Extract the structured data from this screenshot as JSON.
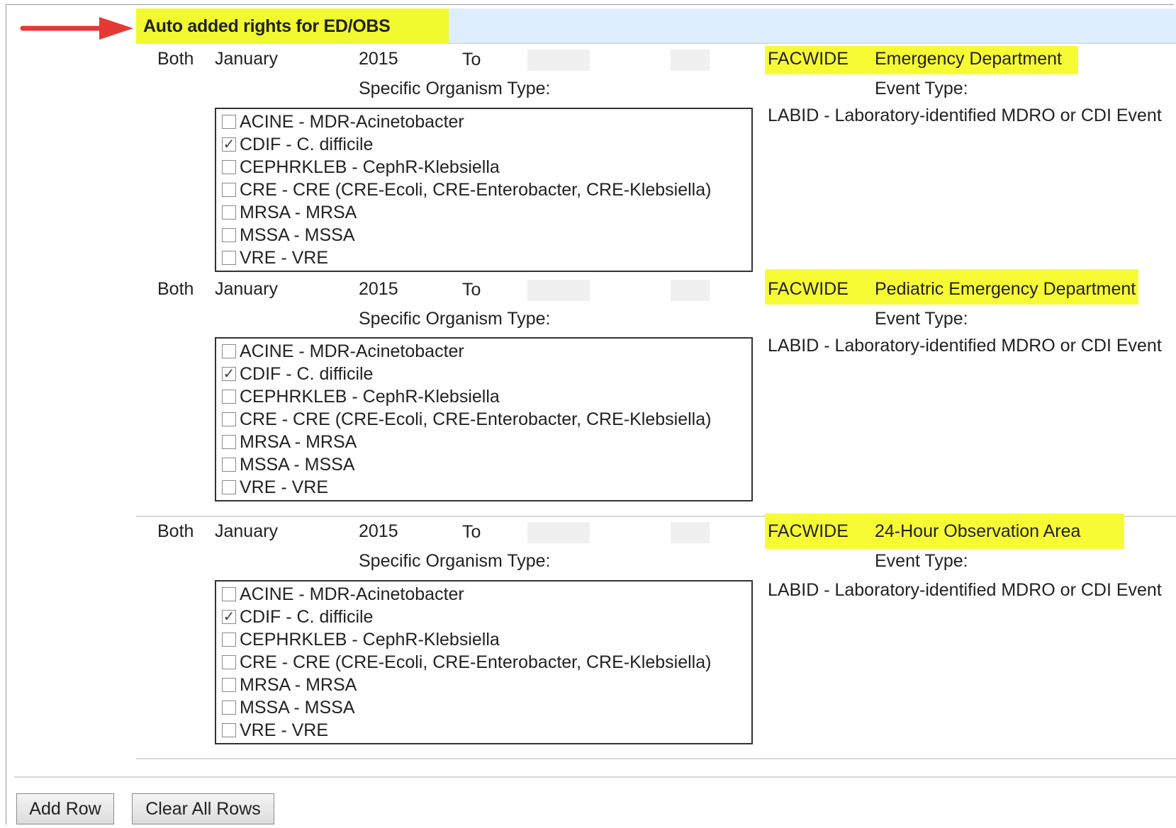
{
  "header": {
    "title": "Auto added rights for ED/OBS",
    "arrow_color": "#e53935",
    "highlight_color": "#f7fb34"
  },
  "rows": [
    {
      "both": "Both",
      "month": "January",
      "year": "2015",
      "to": "To",
      "location_type": "FACWIDE",
      "location": "Emergency Department",
      "organism_label": "Specific Organism Type:",
      "event_type_label": "Event Type:",
      "event_type": "LABID - Laboratory-identified MDRO or CDI Event",
      "organisms": [
        {
          "label": "ACINE - MDR-Acinetobacter",
          "checked": false
        },
        {
          "label": "CDIF - C. difficile",
          "checked": true
        },
        {
          "label": "CEPHRKLEB - CephR-Klebsiella",
          "checked": false
        },
        {
          "label": "CRE - CRE (CRE-Ecoli, CRE-Enterobacter, CRE-Klebsiella)",
          "checked": false
        },
        {
          "label": "MRSA - MRSA",
          "checked": false
        },
        {
          "label": "MSSA - MSSA",
          "checked": false
        },
        {
          "label": "VRE - VRE",
          "checked": false
        }
      ]
    },
    {
      "both": "Both",
      "month": "January",
      "year": "2015",
      "to": "To",
      "location_type": "FACWIDE",
      "location": "Pediatric Emergency Department",
      "organism_label": "Specific Organism Type:",
      "event_type_label": "Event Type:",
      "event_type": "LABID - Laboratory-identified MDRO or CDI Event",
      "organisms": [
        {
          "label": "ACINE - MDR-Acinetobacter",
          "checked": false
        },
        {
          "label": "CDIF - C. difficile",
          "checked": true
        },
        {
          "label": "CEPHRKLEB - CephR-Klebsiella",
          "checked": false
        },
        {
          "label": "CRE - CRE (CRE-Ecoli, CRE-Enterobacter, CRE-Klebsiella)",
          "checked": false
        },
        {
          "label": "MRSA - MRSA",
          "checked": false
        },
        {
          "label": "MSSA - MSSA",
          "checked": false
        },
        {
          "label": "VRE - VRE",
          "checked": false
        }
      ]
    },
    {
      "both": "Both",
      "month": "January",
      "year": "2015",
      "to": "To",
      "location_type": "FACWIDE",
      "location": "24-Hour Observation Area",
      "organism_label": "Specific Organism Type:",
      "event_type_label": "Event Type:",
      "event_type": "LABID - Laboratory-identified MDRO or CDI Event",
      "organisms": [
        {
          "label": "ACINE - MDR-Acinetobacter",
          "checked": false
        },
        {
          "label": "CDIF - C. difficile",
          "checked": true
        },
        {
          "label": "CEPHRKLEB - CephR-Klebsiella",
          "checked": false
        },
        {
          "label": "CRE - CRE (CRE-Ecoli, CRE-Enterobacter, CRE-Klebsiella)",
          "checked": false
        },
        {
          "label": "MRSA - MRSA",
          "checked": false
        },
        {
          "label": "MSSA - MSSA",
          "checked": false
        },
        {
          "label": "VRE - VRE",
          "checked": false
        }
      ]
    }
  ],
  "buttons": {
    "add_row": "Add Row",
    "clear_all_rows": "Clear All Rows"
  }
}
